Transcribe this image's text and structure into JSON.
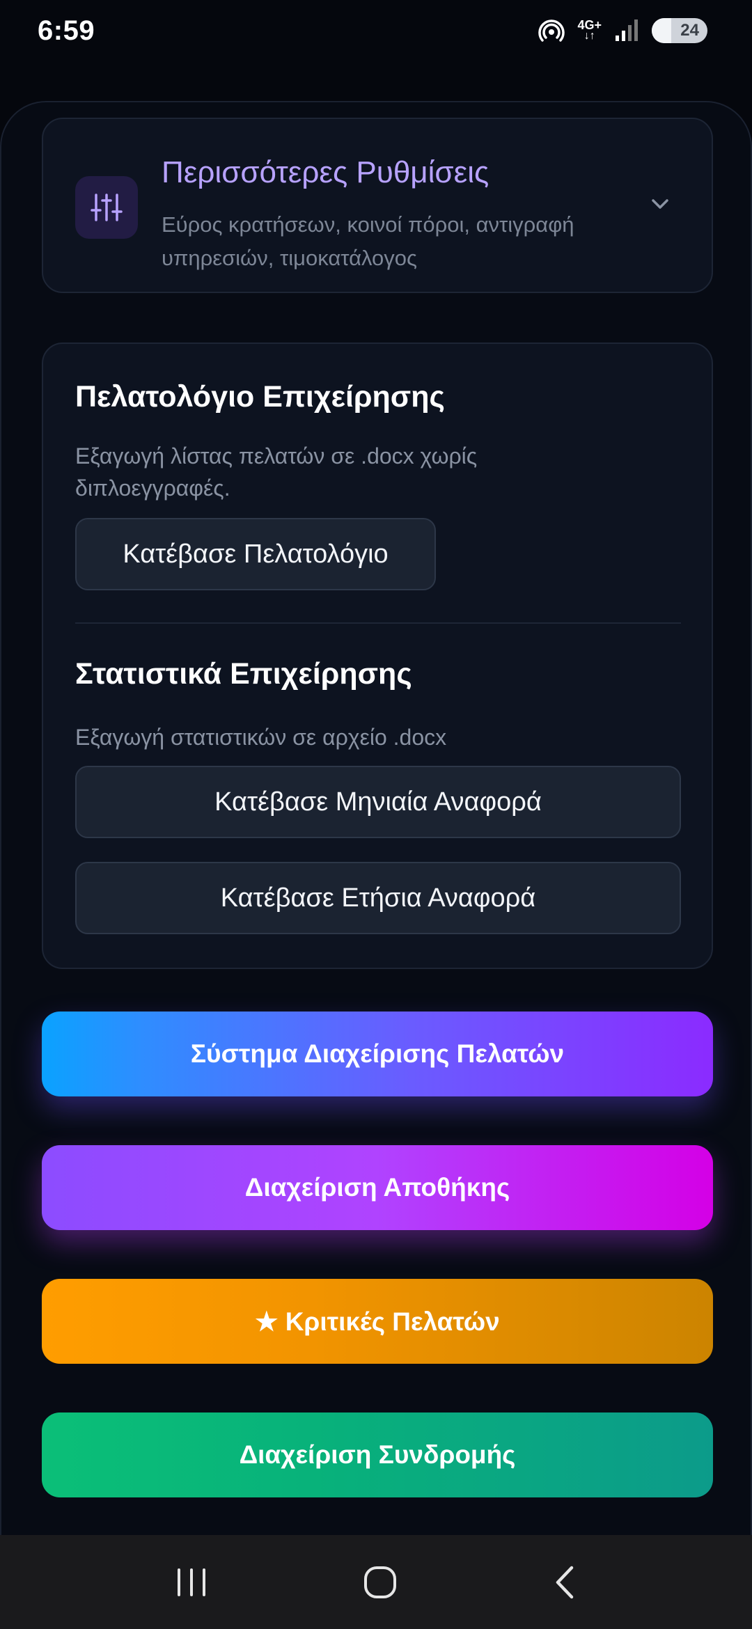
{
  "status_bar": {
    "time": "6:59",
    "network": "4G+",
    "battery": "24"
  },
  "settings": {
    "title": "Περισσότερες Ρυθμίσεις",
    "description": "Εύρος κρατήσεων, κοινοί πόροι, αντιγραφή υπηρεσιών, τιμοκατάλογος",
    "icon": "sliders-icon",
    "accent": "#b7a2ff"
  },
  "clients": {
    "title": "Πελατολόγιο Επιχείρησης",
    "description": "Εξαγωγή λίστας πελατών σε .docx χωρίς διπλοεγγραφές.",
    "download_label": "Κατέβασε Πελατολόγιο"
  },
  "stats": {
    "title": "Στατιστικά Επιχείρησης",
    "description": "Εξαγωγή στατιστικών σε αρχείο .docx",
    "monthly_label": "Κατέβασε Μηνιαία Αναφορά",
    "yearly_label": "Κατέβασε Ετήσια Αναφορά"
  },
  "actions": {
    "crm_label": "Σύστημα Διαχείρισης Πελατών",
    "warehouse_label": "Διαχείριση Αποθήκης",
    "reviews_label": "★ Κριτικές Πελατών",
    "subscription_label": "Διαχείριση Συνδρομής"
  },
  "colors": {
    "background": "#05070d",
    "card": "#0d1320",
    "crm": "#2f8dff",
    "warehouse": "#b043ff",
    "reviews": "#ff9d00",
    "subscription": "#0bbf78"
  }
}
